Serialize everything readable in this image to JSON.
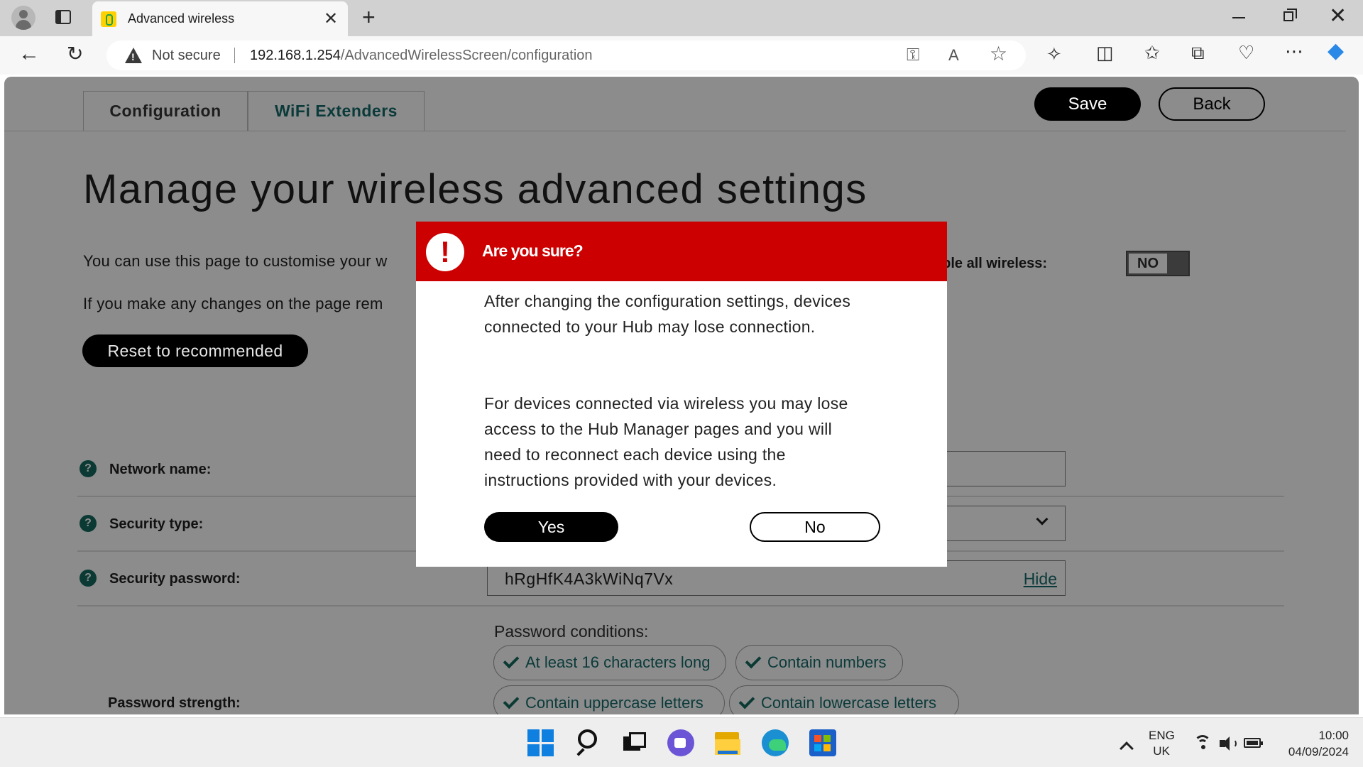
{
  "browser": {
    "tab_title": "Advanced wireless",
    "security_label": "Not secure",
    "url_host": "192.168.1.254",
    "url_path": "/AdvancedWirelessScreen/configuration"
  },
  "page": {
    "tabs": [
      {
        "label": "Configuration"
      },
      {
        "label": "WiFi Extenders"
      }
    ],
    "save_label": "Save",
    "back_label": "Back",
    "title": "Manage your wireless advanced settings",
    "intro_line1": "You can use this page to customise your w",
    "intro_line2": "If you make any changes on the page rem",
    "reset_label": "Reset to recommended",
    "disable_wireless_label": "able all wireless:",
    "disable_wireless_value": "NO",
    "fields": {
      "network_name_label": "Network name:",
      "security_type_label": "Security type:",
      "security_password_label": "Security password:",
      "password_value": "hRgHfK4A3kWiNq7Vx",
      "hide_label": "Hide",
      "password_strength_label": "Password strength:"
    },
    "password_conditions": {
      "heading": "Password conditions:",
      "items": [
        "At least 16 characters long",
        "Contain numbers",
        "Contain uppercase letters",
        "Contain lowercase letters"
      ]
    }
  },
  "modal": {
    "title": "Are you sure?",
    "message1": "After changing the configuration settings, devices connected to your Hub may lose connection.",
    "message2": "For devices connected via wireless you may lose access to the Hub Manager pages and you will need to reconnect each device using the instructions provided with your devices.",
    "yes_label": "Yes",
    "no_label": "No"
  },
  "taskbar": {
    "lang_line1": "ENG",
    "lang_line2": "UK",
    "time": "10:00",
    "date": "04/09/2024"
  },
  "colors": {
    "modal_header": "#cc0000",
    "overlay_page": "#8c8c8c",
    "brand_teal": "#0b3a3a"
  }
}
